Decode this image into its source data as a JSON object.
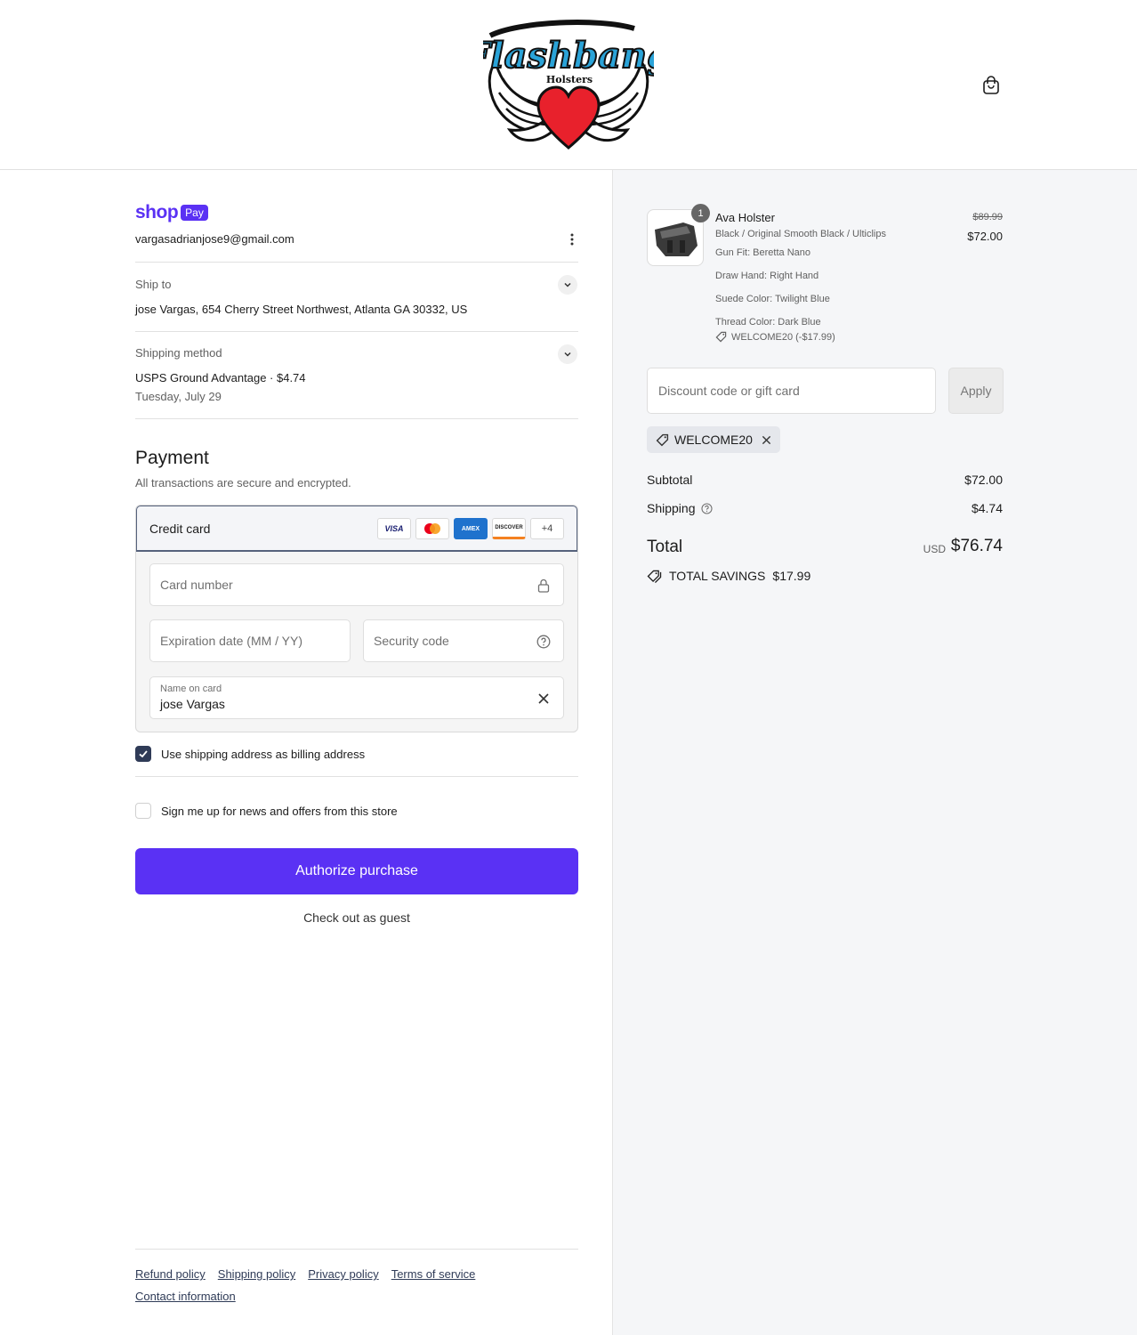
{
  "header": {
    "logo_text": "Flashbang",
    "logo_subtext": "Holsters"
  },
  "account": {
    "brand_word": "shop",
    "brand_badge": "Pay",
    "email": "vargasadrianjose9@gmail.com"
  },
  "ship_to": {
    "label": "Ship to",
    "value": "jose Vargas, 654 Cherry Street Northwest, Atlanta GA 30332, US"
  },
  "shipping_method": {
    "label": "Shipping method",
    "value": "USPS Ground Advantage · $4.74",
    "date": "Tuesday, July 29"
  },
  "payment": {
    "title": "Payment",
    "subtitle": "All transactions are secure and encrypted.",
    "method_label": "Credit card",
    "card_brands": [
      "VISA",
      "Mastercard",
      "AMEX",
      "DISCOVER"
    ],
    "more_brands": "+4",
    "card_number_placeholder": "Card number",
    "expiry_placeholder": "Expiration date (MM / YY)",
    "security_placeholder": "Security code",
    "name_label": "Name on card",
    "name_value": "jose Vargas"
  },
  "options": {
    "billing_same": "Use shipping address as billing address",
    "billing_same_checked": true,
    "newsletter": "Sign me up for news and offers from this store",
    "newsletter_checked": false
  },
  "actions": {
    "authorize": "Authorize purchase",
    "guest": "Check out as guest"
  },
  "footer": {
    "links": [
      "Refund policy",
      "Shipping policy",
      "Privacy policy",
      "Terms of service",
      "Contact information"
    ]
  },
  "order": {
    "quantity": "1",
    "product_name": "Ava Holster",
    "variant": "Black / Original Smooth Black / Ulticlips",
    "details": [
      "Gun Fit: Beretta Nano",
      "Draw Hand: Right Hand",
      "Suede Color: Twilight Blue",
      "Thread Color: Dark Blue"
    ],
    "line_discount": "WELCOME20 (-$17.99)",
    "old_price": "$89.99",
    "price": "$72.00"
  },
  "discount": {
    "placeholder": "Discount code or gift card",
    "apply": "Apply",
    "applied_code": "WELCOME20"
  },
  "summary": {
    "subtotal_label": "Subtotal",
    "subtotal": "$72.00",
    "shipping_label": "Shipping",
    "shipping": "$4.74",
    "total_label": "Total",
    "currency": "USD",
    "total": "$76.74",
    "savings_label": "TOTAL SAVINGS",
    "savings": "$17.99"
  },
  "colors": {
    "accent": "#5a31f4",
    "heart": "#e8212c",
    "logo_blue": "#2aa3d8"
  }
}
